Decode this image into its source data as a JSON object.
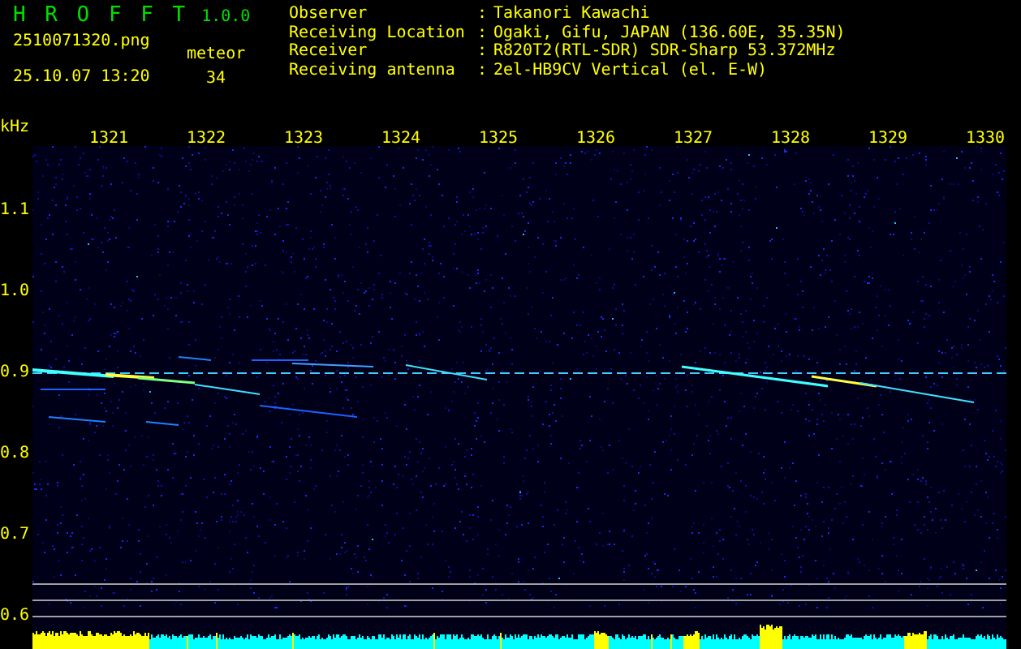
{
  "app": {
    "title": "H R O F F T",
    "version": "1.0.0"
  },
  "file_name": "2510071320.png",
  "timestamp": "25.10.07 13:20",
  "meteor": {
    "label": "meteor",
    "count": "34"
  },
  "station": [
    {
      "label": "Observer",
      "separator": ":",
      "value": "Takanori Kawachi"
    },
    {
      "label": "Receiving Location",
      "separator": ":",
      "value": "Ogaki, Gifu, JAPAN (136.60E, 35.35N)"
    },
    {
      "label": "Receiver",
      "separator": ":",
      "value": "R820T2(RTL-SDR) SDR-Sharp 53.372MHz"
    },
    {
      "label": "Receiving antenna",
      "separator": ":",
      "value": "2el-HB9CV Vertical (el. E-W)"
    }
  ],
  "spectrogram": {
    "unit": "kHz",
    "x_labels": [
      "1321",
      "1322",
      "1323",
      "1324",
      "1325",
      "1326",
      "1327",
      "1328",
      "1329",
      "1330"
    ],
    "y_labels": [
      "1.1",
      "1.0",
      "0.9",
      "0.8",
      "0.7",
      "0.6"
    ]
  }
}
